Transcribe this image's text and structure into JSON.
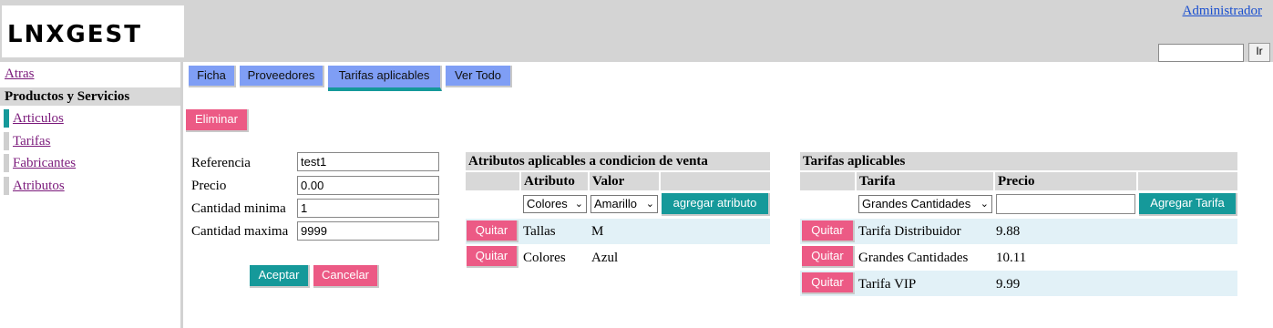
{
  "header": {
    "logo": "LNXGEST",
    "user_link": "Administrador",
    "search": {
      "value": "",
      "button": "Ir"
    }
  },
  "sidebar": {
    "back": "Atras",
    "section": "Productos y Servicios",
    "items": [
      {
        "label": "Articulos",
        "active": true
      },
      {
        "label": "Tarifas",
        "active": false
      },
      {
        "label": "Fabricantes",
        "active": false
      },
      {
        "label": "Atributos",
        "active": false
      }
    ]
  },
  "tabs": [
    {
      "label": "Ficha",
      "active": false
    },
    {
      "label": "Proveedores",
      "active": false
    },
    {
      "label": "Tarifas aplicables",
      "active": true
    },
    {
      "label": "Ver Todo",
      "active": false
    }
  ],
  "actions": {
    "delete": "Eliminar"
  },
  "form": {
    "fields": [
      {
        "label": "Referencia",
        "value": "test1"
      },
      {
        "label": "Precio",
        "value": "0.00"
      },
      {
        "label": "Cantidad minima",
        "value": "1"
      },
      {
        "label": "Cantidad maxima",
        "value": "9999"
      }
    ],
    "accept": "Aceptar",
    "cancel": "Cancelar"
  },
  "attributes": {
    "title": "Atributos aplicables a condicion de venta",
    "columns": [
      "Atributo",
      "Valor"
    ],
    "select_attribute": "Colores",
    "select_value": "Amarillo",
    "add_button": "agregar atributo",
    "rows": [
      {
        "remove": "Quitar",
        "attribute": "Tallas",
        "value": "M"
      },
      {
        "remove": "Quitar",
        "attribute": "Colores",
        "value": "Azul"
      }
    ]
  },
  "tariffs": {
    "title": "Tarifas aplicables",
    "columns": [
      "Tarifa",
      "Precio"
    ],
    "select_tariff": "Grandes Cantidades",
    "price_input": "",
    "add_button": "Agregar Tarifa",
    "rows": [
      {
        "remove": "Quitar",
        "tariff": "Tarifa Distribuidor",
        "price": "9.88"
      },
      {
        "remove": "Quitar",
        "tariff": "Grandes Cantidades",
        "price": "10.11"
      },
      {
        "remove": "Quitar",
        "tariff": "Tarifa VIP",
        "price": "9.99"
      }
    ]
  },
  "colors": {
    "accent_teal": "#15999a",
    "danger_pink": "#ec5a85",
    "tab_blue": "#7f9ef5",
    "header_gray": "#d4d4d4",
    "row_highlight": "#e2f1f7"
  },
  "icons": {
    "select_chevron": "chevron-down-icon"
  }
}
